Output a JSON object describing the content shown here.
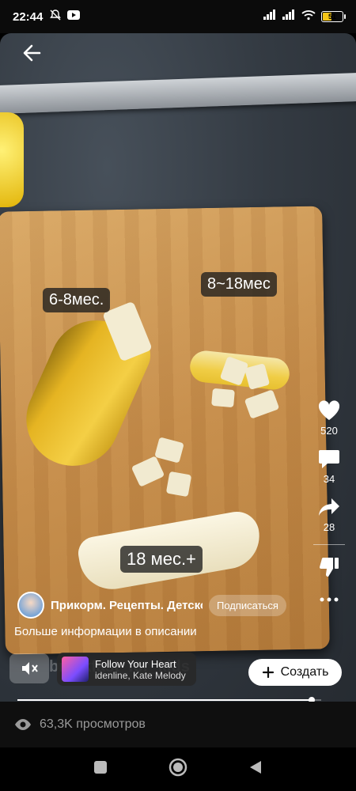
{
  "status_bar": {
    "time": "22:44",
    "battery_level": "51",
    "icons": [
      "mute-icon",
      "youtube-icon",
      "signal-icon",
      "signal-icon",
      "wifi-icon",
      "battery-icon"
    ]
  },
  "video": {
    "overlay_labels": [
      "6-8мес.",
      "8~18мес",
      "18 мес.+"
    ]
  },
  "actions": {
    "like_count": "520",
    "comments_count": "34",
    "share_count": "28"
  },
  "channel": {
    "name": "Прикорм. Рецепты. Детское",
    "subscribe_label": "Подписаться"
  },
  "description": "Больше информации в описании",
  "ghost_username": "breakfast_for_kids",
  "music": {
    "title": "Follow Your Heart",
    "artist": "idenline, Kate Melody"
  },
  "create_label": "Создать",
  "progress": 0.97,
  "views_text": "63,3K просмотров",
  "colors": {
    "battery": "#f5c518",
    "create_button_bg": "#ffffff"
  }
}
